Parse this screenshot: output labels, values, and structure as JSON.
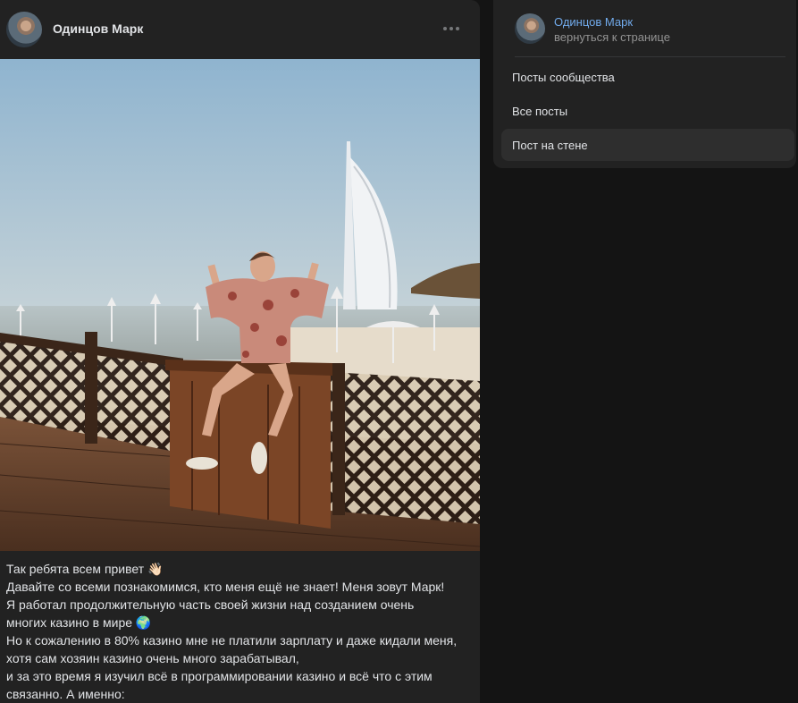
{
  "post": {
    "author": "Одинцов Марк",
    "more_icon": "ellipsis-icon",
    "text_lines": [
      "Так ребята всем привет 👋🏻",
      "Давайте со всеми познакомимся, кто меня ещё не знает! Меня зовут Марк!",
      "Я работал продолжительную часть своей жизни над созданием очень",
      "многих казино в мире 🌍",
      "Но к сожалению в 80% казино мне не платили зарплату и даже кидали меня,",
      "хотя сам хозяин казино очень много зарабатывал,",
      "и за это время я изучил всё в программировании казино и всё что с этим",
      "связанно. А именно:"
    ]
  },
  "sidebar": {
    "name": "Одинцов Марк",
    "back_link": "вернуться к странице",
    "items": [
      {
        "label": "Посты сообщества",
        "active": false
      },
      {
        "label": "Все посты",
        "active": false
      },
      {
        "label": "Пост на стене",
        "active": true
      }
    ]
  },
  "colors": {
    "background": "#141414",
    "card": "#222222",
    "link": "#71aaeb",
    "muted": "#939393",
    "active_item": "#2e2e2e"
  }
}
